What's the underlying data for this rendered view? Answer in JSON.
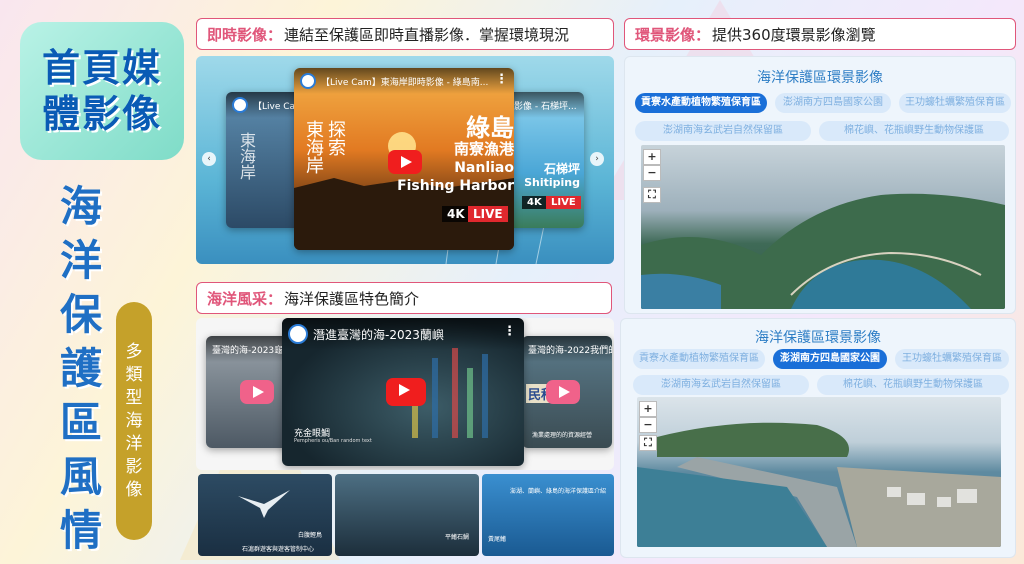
{
  "left": {
    "title_line1": "首頁媒",
    "title_line2": "體影像",
    "vertical_title": [
      "海",
      "洋",
      "保",
      "護",
      "區",
      "風",
      "情"
    ],
    "pill_chars": [
      "多",
      "類",
      "型",
      "海",
      "洋",
      "影",
      "像"
    ]
  },
  "live_section": {
    "header_bold": "即時影像：",
    "header_text": "連結至保護區即時直播影像．掌握環境現況",
    "main_video_title": "【Live Cam】東海岸即時影像 - 綠島南...",
    "left_video_title": "【Live Cam】",
    "right_video_title": "影像 - 石梯坪...",
    "main_overlay_title": "綠島",
    "main_overlay_sub": "南寮漁港",
    "main_overlay_en1": "Nanliao",
    "main_overlay_en2": "Fishing Harbor",
    "right_overlay_title": "石梯坪",
    "right_overlay_en": "Shitiping",
    "calligraphy_left": "東海岸",
    "calligraphy_right": "探索",
    "badge_4k": "4K",
    "badge_live": "LIVE",
    "logo_small": "Explore East Coast of Taiwan"
  },
  "feature_section": {
    "header_bold": "海洋風采：",
    "header_text": "海洋保護區特色簡介",
    "main_video_title": "潛進臺灣的海-2023蘭嶼",
    "main_caption": "充金眼鯛",
    "main_caption_en": "Pempheris ou/Ban random text",
    "left_video_title": "臺灣的海-2023龜山",
    "right_video_title": "臺灣的海-2022我們的海",
    "right_caption": "漁業處理的的資源經營",
    "right_sign": "民科",
    "thumb1_caption": "石滬群遊客與遊客管制中心",
    "thumb1_label": "白腹鰹鳥",
    "thumb2_label": "平鰭石鯛",
    "thumb3_text": "澎湖、蘭嶼、綠島的海洋保護區介紹",
    "thumb3_label": "黃尾鰭"
  },
  "pano_section": {
    "header_bold": "環景影像：",
    "header_text": "提供360度環景影像瀏覽",
    "panel_title": "海洋保護區環景影像",
    "tags": [
      "貢寮水產動植物繁殖保育區",
      "澎湖南方四島國家公園",
      "王功蠔牡蠣繁殖保育區",
      "澎湖南海玄武岩自然保留區",
      "棉花嶼、花瓶嶼野生動物保護區"
    ],
    "panel1_active": 0,
    "panel2_active": 1,
    "zoom_in": "+",
    "zoom_out": "−",
    "fullscreen": "⛶"
  },
  "colors": {
    "accent_pink": "#e0567a",
    "title_blue": "#1f6fc4",
    "tag_active": "#1a6fd8",
    "tag_inactive": "#d9e9fa",
    "pill_gold": "#c5a12a",
    "youtube_red": "#f01e1e"
  },
  "icons": [
    "youtube-play-icon",
    "chevron-left-icon",
    "chevron-right-icon",
    "more-icon",
    "live-dot-icon",
    "zoom-in-icon",
    "zoom-out-icon",
    "fullscreen-icon"
  ]
}
